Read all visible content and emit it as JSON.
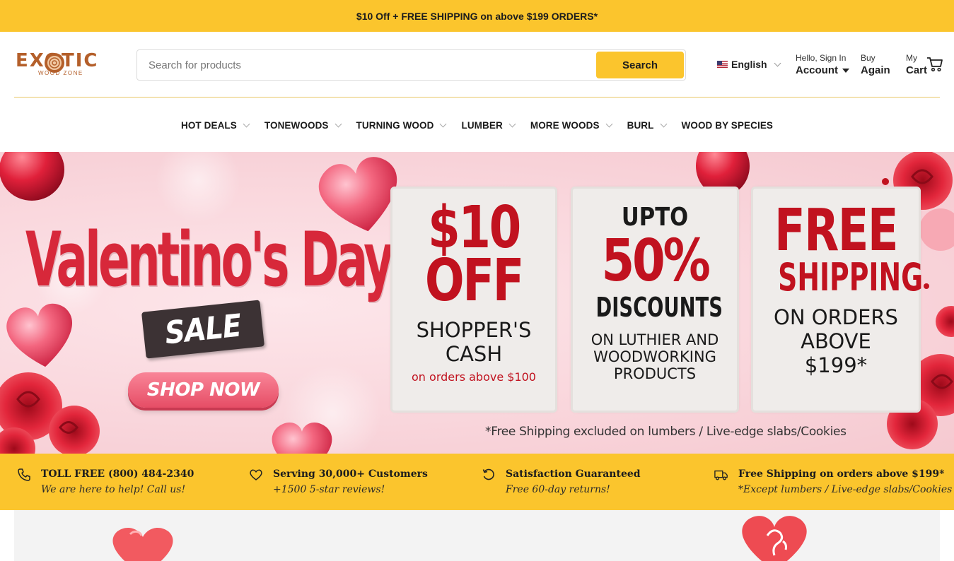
{
  "promo": {
    "text": "$10 Off + FREE SHIPPING on above $199 ORDERS*"
  },
  "brand": {
    "name": "EXOTIC",
    "tagline": "WOOD ZONE"
  },
  "search": {
    "placeholder": "Search for products",
    "button": "Search"
  },
  "language": {
    "label": "English"
  },
  "account": {
    "greeting": "Hello, Sign In",
    "label": "Account"
  },
  "buy_again": {
    "top": "Buy",
    "label": "Again"
  },
  "cart": {
    "top": "My",
    "label": "Cart"
  },
  "nav": {
    "items": [
      {
        "label": "HOT DEALS",
        "has_dropdown": true
      },
      {
        "label": "TONEWOODS",
        "has_dropdown": true
      },
      {
        "label": "TURNING WOOD",
        "has_dropdown": true
      },
      {
        "label": "LUMBER",
        "has_dropdown": true
      },
      {
        "label": "MORE WOODS",
        "has_dropdown": true
      },
      {
        "label": "BURL",
        "has_dropdown": true
      },
      {
        "label": "WOOD BY SPECIES",
        "has_dropdown": false
      }
    ]
  },
  "hero": {
    "title": "Valentino's Day",
    "sale": "SALE",
    "cta": "SHOP NOW",
    "card1": {
      "big1": "$10",
      "big2": "OFF",
      "line1": "SHOPPER'S",
      "line2": "CASH",
      "small": "on orders above $100"
    },
    "card2": {
      "top": "UPTO",
      "big": "50%",
      "mid": "DISCOUNTS",
      "line1": "ON LUTHIER AND",
      "line2": "WOODWORKING",
      "line3": "PRODUCTS"
    },
    "card3": {
      "big1": "FREE",
      "big2": "SHIPPING",
      "line1": "ON ORDERS",
      "line2": "ABOVE",
      "line3": "$199*"
    },
    "note": "*Free Shipping excluded on lumbers / Live-edge slabs/Cookies"
  },
  "features": [
    {
      "icon": "phone-icon",
      "title": "TOLL FREE (800) 484-2340",
      "subtitle": "We are here to help! Call us!"
    },
    {
      "icon": "heart-icon",
      "title": "Serving 30,000+ Customers",
      "subtitle": "+1500 5-star reviews!"
    },
    {
      "icon": "refresh-icon",
      "title": "Satisfaction Guaranteed",
      "subtitle": "Free 60-day returns!"
    },
    {
      "icon": "truck-icon",
      "title": "Free Shipping on orders above $199*",
      "subtitle": "*Except lumbers / Live-edge slabs/Cookies"
    }
  ],
  "colors": {
    "accent": "#fbc52d",
    "brand": "#b45f2a",
    "hero_red": "#c1121f"
  }
}
